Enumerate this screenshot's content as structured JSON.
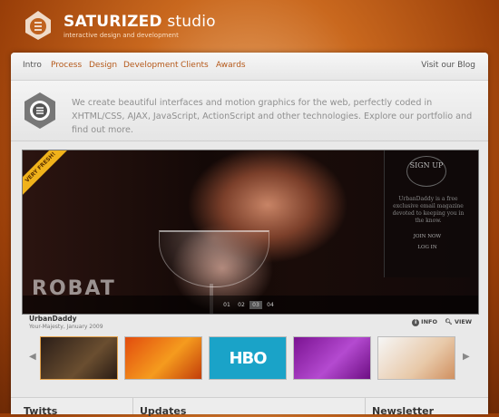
{
  "brand": {
    "name": "SATURIZED",
    "name_suffix": " studio",
    "tagline": "interactive design and development"
  },
  "nav": {
    "items": [
      "Intro",
      "Process",
      "Design",
      "Development",
      "Clients",
      "Awards"
    ],
    "blog": "Visit our Blog"
  },
  "intro": {
    "text": "We create beautiful interfaces and motion graphics for the web, perfectly coded in XHTML/CSS, AJAX, JavaScript, ActionScript and other technologies. Explore our portfolio and find out more."
  },
  "showcase": {
    "ribbon": "VERY FRESH!",
    "overlay_word": "ROBAT",
    "signup": {
      "title": "SIGN UP",
      "blurb": "UrbanDaddy is a free exclusive email magazine devoted to keeping you in the know.",
      "join": "JOIN NOW",
      "login": "LOG IN"
    },
    "pages": [
      "01",
      "02",
      "03",
      "04"
    ],
    "current_page": "03"
  },
  "caption": {
    "title": "UrbanDaddy",
    "subtitle": "Your-Majesty, January 2009",
    "info": "INFO",
    "view": "VIEW"
  },
  "thumbnails": [
    {
      "name": "thumb-1",
      "colors": [
        "#3a2a22",
        "#8a6a40"
      ]
    },
    {
      "name": "thumb-2",
      "colors": [
        "#e55a12",
        "#f7a21a"
      ]
    },
    {
      "name": "thumb-hbo",
      "label": "HBO",
      "colors": [
        "#1aa3c8",
        "#4fc4e0"
      ]
    },
    {
      "name": "thumb-4",
      "colors": [
        "#8a1aa0",
        "#b24fc8"
      ]
    },
    {
      "name": "thumb-5",
      "colors": [
        "#f2f2f2",
        "#d9b08a"
      ]
    }
  ],
  "bottom": {
    "col1": "Twitts",
    "col2": "Updates",
    "col3": "Newsletter"
  },
  "colors": {
    "accent": "#b5591a",
    "ribbon": "#f0b21b",
    "hbo_blue": "#1aa3c8"
  }
}
